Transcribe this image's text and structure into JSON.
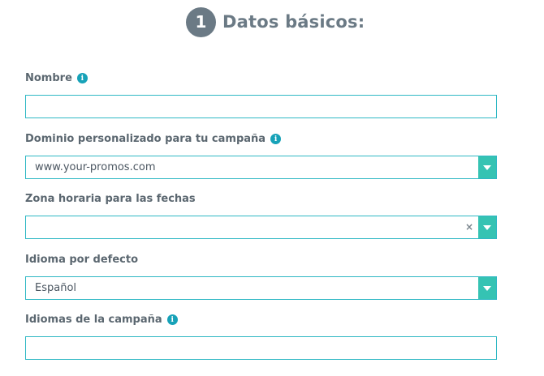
{
  "header": {
    "step": "1",
    "title": "Datos básicos:"
  },
  "fields": {
    "name": {
      "label": "Nombre",
      "value": ""
    },
    "domain": {
      "label": "Dominio personalizado para tu campaña",
      "value": "www.your-promos.com"
    },
    "timezone": {
      "label": "Zona horaria para las fechas",
      "value": "",
      "clear": "×"
    },
    "language": {
      "label": "Idioma por defecto",
      "value": "Español"
    },
    "languages": {
      "label": "Idiomas de la campaña",
      "value": ""
    }
  },
  "info_glyph": "i",
  "colors": {
    "accent": "#2fb8c4",
    "button": "#35c3b3",
    "step": "#6b7a85",
    "info": "#17a2b8"
  }
}
